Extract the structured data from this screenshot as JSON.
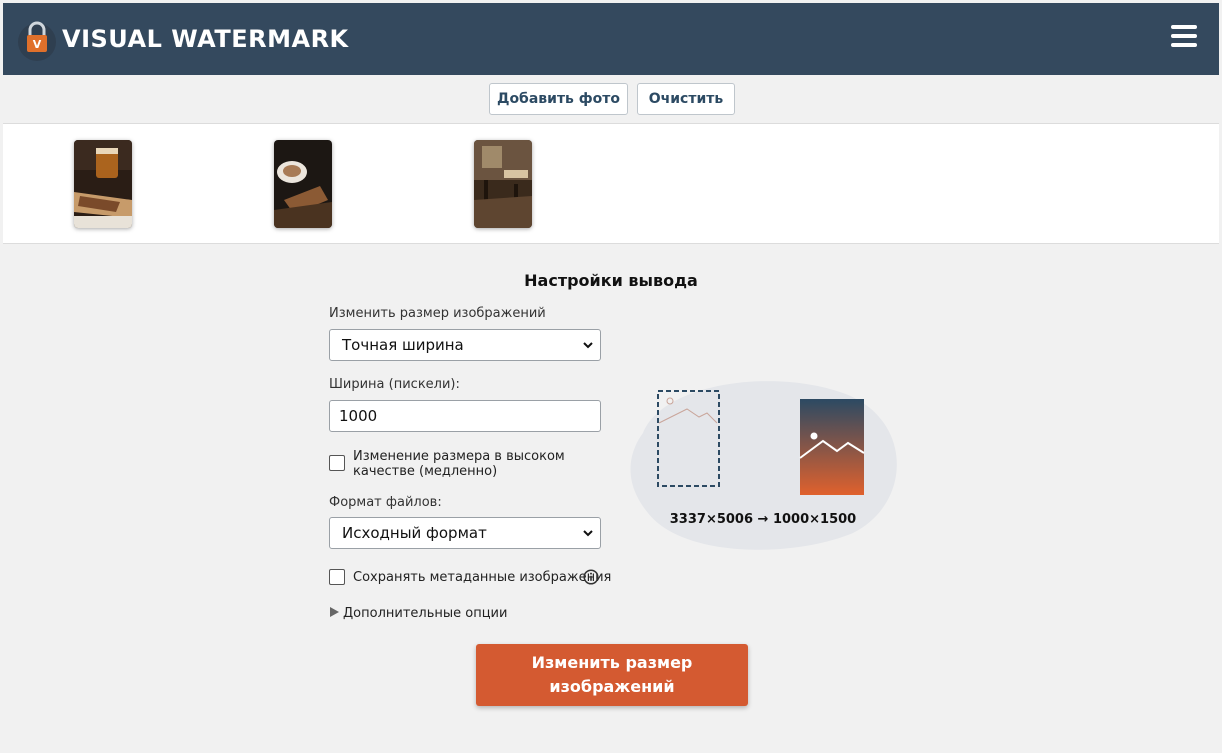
{
  "app": {
    "name": "VISUAL WATERMARK"
  },
  "toolbar": {
    "add_photo": "Добавить фото",
    "clear": "Очистить"
  },
  "thumbnails": [
    {
      "name": "thumb-drink-pastry"
    },
    {
      "name": "thumb-coffee-croissant"
    },
    {
      "name": "thumb-cafe-chairs"
    }
  ],
  "settings": {
    "title": "Настройки вывода",
    "resize_label": "Изменить размер изображений",
    "resize_mode": "Точная ширина",
    "width_label": "Ширина (пискели):",
    "width_value": "1000",
    "hq_label": "Изменение размера в высоком качестве (медленно)",
    "hq_checked": false,
    "format_label": "Формат файлов:",
    "format_value": "Исходный формат",
    "metadata_label": "Сохранять метаданные изображения",
    "metadata_checked": false,
    "advanced_label": "Дополнительные опции",
    "submit_label": "Изменить размер изображений",
    "dimensions": "3337×5006 → 1000×1500"
  },
  "colors": {
    "header": "#34495e",
    "accent": "#d45a31",
    "link": "#2c4a63"
  }
}
